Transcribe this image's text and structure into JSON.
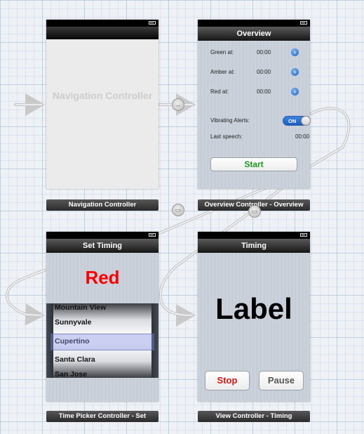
{
  "colors": {
    "start": "#1a9a1a",
    "red_label": "#ff0000",
    "stop": "#e01010",
    "toggle_on": "#2a6fd6"
  },
  "nav_scene": {
    "placeholder_text": "Navigation Controller",
    "label": "Navigation Controller"
  },
  "overview_scene": {
    "title": "Overview",
    "rows": [
      {
        "label": "Green at:",
        "value": "00:00"
      },
      {
        "label": "Amber at:",
        "value": "00:00"
      },
      {
        "label": "Red at:",
        "value": "00:00"
      }
    ],
    "vibrating_label": "Vibrating Alerts:",
    "toggle_text": "ON",
    "last_speech_label": "Last speech:",
    "last_speech_value": "00:00",
    "start_button": "Start",
    "label": "Overview Controller - Overview"
  },
  "set_timing_scene": {
    "title": "Set Timing",
    "color_label": "Red",
    "picker_items": [
      "Mountain View",
      "Sunnyvale",
      "Cupertino",
      "Santa Clara",
      "San Jose"
    ],
    "selected_item": "Cupertino",
    "label": "Time Picker Controller - Set"
  },
  "timing_scene": {
    "title": "Timing",
    "big_label": "Label",
    "stop_button": "Stop",
    "pause_button": "Pause",
    "label": "View Controller - Timing"
  },
  "icons": {
    "relationship_segue": "relationship-segue-icon",
    "push_segue": "push-segue-icon",
    "entry_arrow": "entry-arrow-icon",
    "battery": "battery-icon"
  }
}
